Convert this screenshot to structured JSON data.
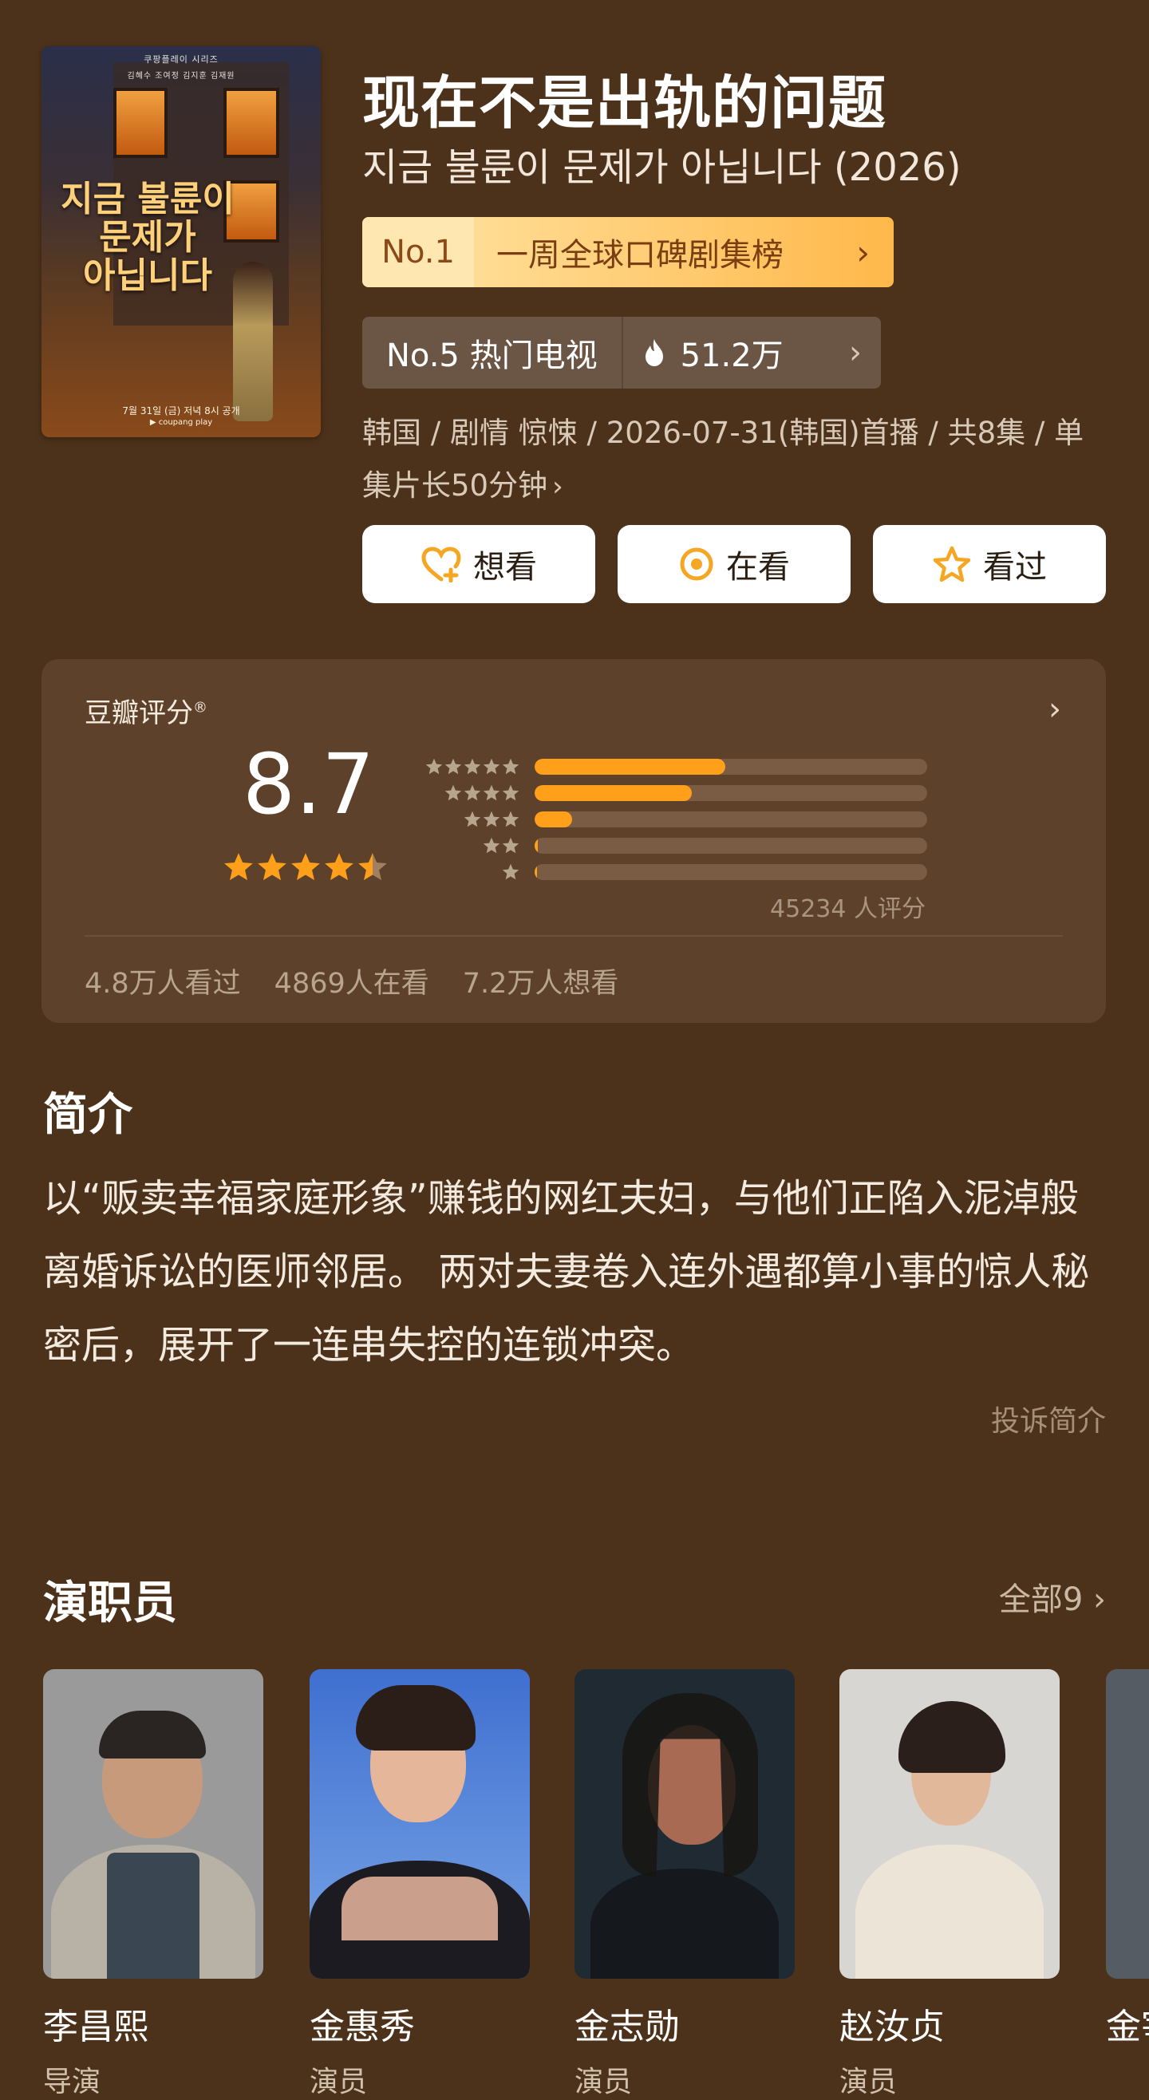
{
  "poster": {
    "top_text": "쿠팡플레이 시리즈",
    "cast_line": "김혜수   조여정   김지훈   김재원",
    "title_kr_1": "지금 불륜이",
    "title_kr_2": "문제가",
    "title_kr_3": "아닙니다",
    "date_text": "7월 31일 (금) 저녁 8시 공개",
    "platform_text": "▶ coupang play"
  },
  "title": {
    "cn": "现在不是出轨的问题",
    "kr": "지금 불륜이 문제가 아닙니다 (2026)"
  },
  "rank": {
    "no": "No.1",
    "label": "一周全球口碑剧集榜",
    "chevron": "›"
  },
  "hot": {
    "label": "No.5 热门电视",
    "heat": "51.2万",
    "chevron": "›"
  },
  "meta": {
    "text": "韩国 / 剧情 惊悚 / 2026-07-31(韩国)首播 / 共8集 / 单集片长50分钟",
    "chevron": "›"
  },
  "actions": {
    "want": "想看",
    "watching": "在看",
    "watched": "看过"
  },
  "rating": {
    "label": "豆瓣评分",
    "registered": "®",
    "score": "8.7",
    "stars": 4.5,
    "distribution": [
      {
        "stars": 5,
        "fraction": 0.485
      },
      {
        "stars": 4,
        "fraction": 0.4
      },
      {
        "stars": 3,
        "fraction": 0.095
      },
      {
        "stars": 2,
        "fraction": 0.008
      },
      {
        "stars": 1,
        "fraction": 0.006
      }
    ],
    "count_text": "45234 人评分",
    "watched": "4.8万人看过",
    "watching": "4869人在看",
    "want": "7.2万人想看"
  },
  "intro": {
    "title": "简介",
    "text": "以“贩卖幸福家庭形象”赚钱的网红夫妇，与他们正陷入泥淖般离婚诉讼的医师邻居。 两对夫妻卷入连外遇都算小事的惊人秘密后，展开了一连串失控的连锁冲突。",
    "report": "投诉简介"
  },
  "cast": {
    "title": "演职员",
    "all": "全部9",
    "members": [
      {
        "name": "李昌熙",
        "role": "导演"
      },
      {
        "name": "金惠秀",
        "role": "演员"
      },
      {
        "name": "金志勋",
        "role": "演员"
      },
      {
        "name": "赵汝贞",
        "role": "演员"
      },
      {
        "name": "金宰",
        "role": ""
      }
    ]
  },
  "colors": {
    "background": "#4d321b",
    "panel": "#5e412a",
    "accent_orange": "#ff9f1a",
    "rank_gradient_start": "#ffe6a8",
    "rank_gradient_end": "#ffb84a"
  }
}
